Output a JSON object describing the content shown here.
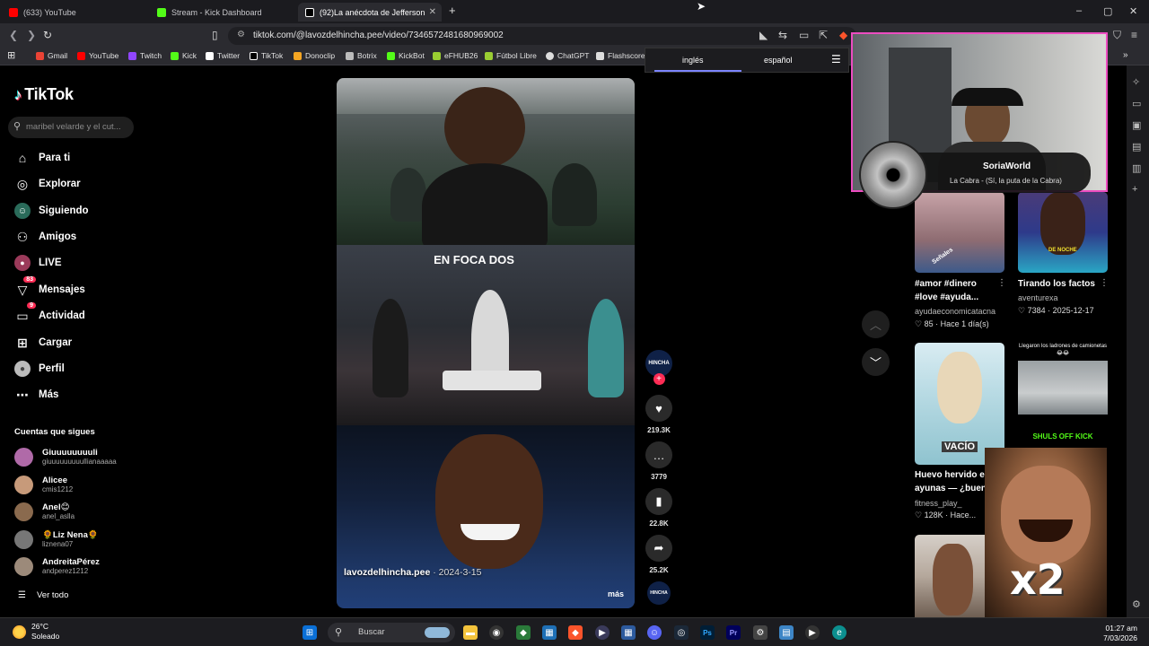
{
  "browser": {
    "tabs": [
      {
        "title": "(633) YouTube",
        "favicon_color": "#ff0000"
      },
      {
        "title": "Stream - Kick Dashboard",
        "favicon_color": "#53fc18"
      },
      {
        "title": "(92)La anécdota de Jefferson",
        "favicon_color": "#ffffff"
      }
    ],
    "new_tab": "+",
    "window_controls": [
      "–",
      "▢",
      "✕"
    ],
    "url": "tiktok.com/@lavozdelhincha.pee/video/7346572481680969002",
    "bookmarks": [
      {
        "label": "Gmail",
        "color": "#ea4335"
      },
      {
        "label": "YouTube",
        "color": "#ff0000"
      },
      {
        "label": "Twitch",
        "color": "#9146ff"
      },
      {
        "label": "Kick",
        "color": "#53fc18"
      },
      {
        "label": "Twitter",
        "color": "#ffffff"
      },
      {
        "label": "TikTok",
        "color": "#ffffff"
      },
      {
        "label": "Donoclip",
        "color": "#f5a623"
      },
      {
        "label": "Botrix",
        "color": "#bbbbbb"
      },
      {
        "label": "KickBot",
        "color": "#53fc18"
      },
      {
        "label": "eFHUB26",
        "color": "#9acd32"
      },
      {
        "label": "Fútbol Libre",
        "color": "#9acd32"
      },
      {
        "label": "ChatGPT",
        "color": "#dddddd"
      },
      {
        "label": "Flashscore",
        "color": "#dddddd"
      }
    ]
  },
  "translate": {
    "tab_active": "inglés",
    "tab_other": "español"
  },
  "sidebar": {
    "logo": "TikTok",
    "search_placeholder": "maribel velarde y el cut...",
    "nav": [
      {
        "label": "Para ti",
        "icon": "home-icon"
      },
      {
        "label": "Explorar",
        "icon": "compass-icon"
      },
      {
        "label": "Siguiendo",
        "icon": "following-icon"
      },
      {
        "label": "Amigos",
        "icon": "friends-icon"
      },
      {
        "label": "LIVE",
        "icon": "live-icon"
      },
      {
        "label": "Mensajes",
        "icon": "messages-icon",
        "badge": "83"
      },
      {
        "label": "Actividad",
        "icon": "activity-icon",
        "badge": "9"
      },
      {
        "label": "Cargar",
        "icon": "upload-icon"
      },
      {
        "label": "Perfil",
        "icon": "profile-icon"
      },
      {
        "label": "Más",
        "icon": "more-icon"
      }
    ],
    "following_title": "Cuentas que sigues",
    "accounts": [
      {
        "name": "Giuuuuuuuuli",
        "handle": "giuuuuuuuuullianaaaaa",
        "color": "#b06aa8"
      },
      {
        "name": "Alicee",
        "handle": "cmis1212",
        "color": "#c79a7a"
      },
      {
        "name": "Anel😊",
        "handle": "anel_aslla",
        "color": "#8a6a4e"
      },
      {
        "name": "🌻Liz Nena🌻",
        "handle": "liznena07",
        "color": "#777777"
      },
      {
        "name": "AndreitaPérez",
        "handle": "andperez1212",
        "color": "#9c8a7a"
      }
    ],
    "see_all": "Ver todo"
  },
  "video": {
    "author": "lavozdelhincha.pee",
    "date": " · 2024-3-15",
    "more": "más",
    "sponsor_title": "EN FOCA DOS"
  },
  "actions": {
    "likes": "219.3K",
    "comments": "3779",
    "saves": "22.8K",
    "shares": "25.2K",
    "avatar_label": "HINCHA"
  },
  "overlay": {
    "streamer": "SoriaWorld",
    "song": "La Cabra - (Sí, la puta de la Cabra)",
    "meme_text": "x2"
  },
  "feed": [
    {
      "title": "#amor #dinero",
      "title2": "#love #ayuda...",
      "author": "ayudaeconomicatacna",
      "likes": "85",
      "date": "Hace 1 día(s)",
      "thumb_caption": "Señales"
    },
    {
      "title": "Tirando los factos",
      "author": "aventurexa",
      "likes": "7384",
      "date": "2025-12-17",
      "thumb_caption": "DE NOCHE"
    },
    {
      "title": "Huevo hervido en",
      "title2": "ayunas — ¿buen...",
      "author": "fitness_play_",
      "likes": "128K",
      "date": "Hace...",
      "thumb_caption": "VACÍO"
    },
    {
      "title": "",
      "thumb_caption": "Llegaron los ladrones de camionetas😂😂",
      "thumb_caption2": "SHULS OFF KICK"
    }
  ],
  "taskbar": {
    "temp": "26°C",
    "condition": "Soleado",
    "search": "Buscar",
    "time": "01:27 am",
    "date": "7/03/2026"
  }
}
